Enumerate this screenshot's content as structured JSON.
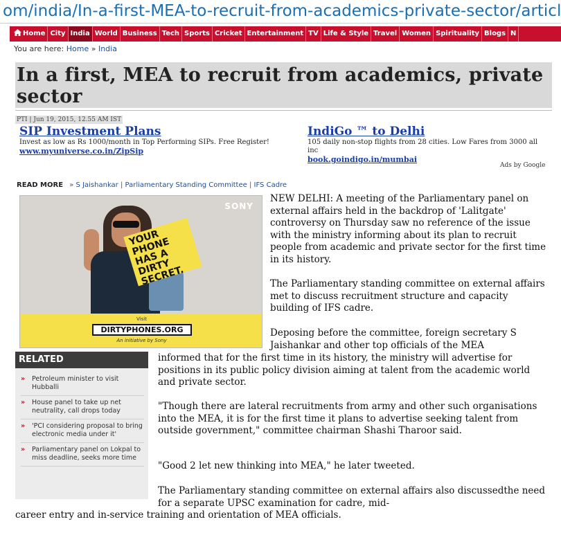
{
  "url_fragment": "om/india/In-a-first-MEA-to-recruit-from-academics-private-sector/articles",
  "nav": {
    "items": [
      "Home",
      "City",
      "India",
      "World",
      "Business",
      "Tech",
      "Sports",
      "Cricket",
      "Entertainment",
      "TV",
      "Life & Style",
      "Travel",
      "Women",
      "Spirituality",
      "Blogs",
      "N"
    ],
    "active": "India"
  },
  "breadcrumb": {
    "prefix": "You are here:",
    "home": "Home",
    "sep": "»",
    "current": "India"
  },
  "article": {
    "headline": "In a first, MEA to recruit from academics, private sector",
    "dateline": "PTI | Jun 19, 2015, 12.55 AM IST",
    "body": {
      "p1": "NEW DELHI: A meeting of the Parliamentary panel on external affairs held in the backdrop of 'Lalitgate' controversy on Thursday saw no reference of the issue with the ministry informing about its plan to recruit people from academic and private sector for the first time in its history.",
      "p2": "The Parliamentary standing committee on external affairs met to discuss recruitment structure and capacity building of IFS cadre.",
      "p3a": "Deposing before the committee, foreign secretary S Jaishankar and other top officials of the MEA",
      "p3b": "informed that for the first time in its history, the ministry will advertise for positions in its public policy division aiming at talent from the academic world and private sector.",
      "p4": "\"Though there are lateral recruitments from army and other such organisations into the MEA, it is for the first time it plans to advertise seeking talent from outside government,\" committee chairman Shashi Tharoor said.",
      "p5": "\"Good 2 let new thinking into MEA,\" he later tweeted.",
      "p6a": "The Parliamentary standing committee on external affairs also discussedthe need for a separate UPSC examination for cadre, mid-",
      "p6b": "career entry and in-service training and orientation of MEA officials."
    }
  },
  "ads": [
    {
      "title": "SIP Investment Plans",
      "desc": "Invest as low as Rs 1000/month in Top Performing SIPs. Free Register!",
      "url": "www.myuniverse.co.in/ZipSip"
    },
    {
      "title": "IndiGo ™ to Delhi",
      "desc": "105 daily non-stop flights from 28 cities. Low Fares from 3000 all inc",
      "url": "book.goindigo.in/mumbai"
    }
  ],
  "ads_by": "Ads by Google",
  "read_more": {
    "label": "READ MORE",
    "bullet": "»",
    "links": [
      "S Jaishankar",
      "Parliamentary Standing Committee",
      "IFS Cadre"
    ],
    "sep": "|"
  },
  "display_ad": {
    "brand": "SONY",
    "slogan": [
      "YOUR",
      "PHONE",
      "HAS A",
      "DIRTY",
      "SECRET."
    ],
    "visit": "Visit",
    "url": "DIRTYPHONES.ORG",
    "initiative": "An initiative by Sony",
    "colors": {
      "yellow": "#f5e04a"
    }
  },
  "related": {
    "heading": "RELATED",
    "bullet": "»",
    "items": [
      "Petroleum minister to visit Hubballi",
      "House panel to take up net neutrality, call drops today",
      "'PCI considering proposal to bring electronic media under it'",
      "Parliamentary panel on Lokpal to miss deadline, seeks more time"
    ]
  },
  "colors": {
    "nav_red": "#c8102e",
    "link_blue": "#1a3ea8",
    "url_blue": "#1a6fb5",
    "related_head": "#3c3c3c"
  }
}
